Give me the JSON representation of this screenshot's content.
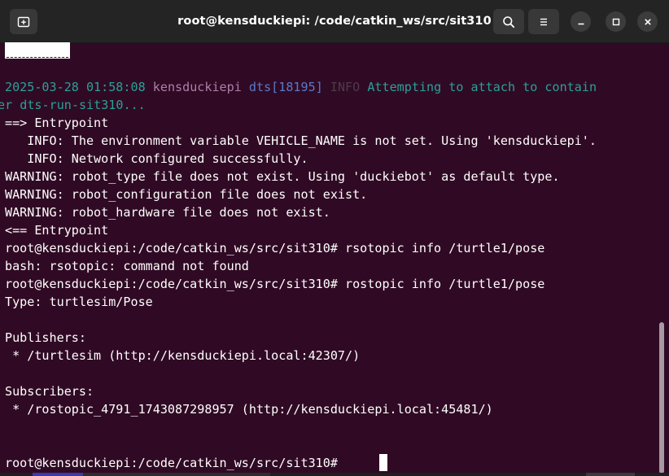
{
  "window": {
    "title": "root@kensduckiepi: /code/catkin_ws/src/sit310"
  },
  "titlebar": {
    "icons": {
      "new_tab": "new-tab-icon",
      "search": "search-icon",
      "menu": "hamburger-menu-icon",
      "minimize": "minimize-icon",
      "maximize": "maximize-icon",
      "close": "close-icon"
    }
  },
  "colors": {
    "terminal_bg": "#300a24",
    "titlebar_bg": "#242424",
    "text": "#ffffff",
    "timestamp": "#2aa198",
    "hostname": "#ad7fa8",
    "process": "#5b79c9",
    "level": "#4e3b4b",
    "message": "#2aa198"
  },
  "terminal": {
    "log": {
      "timestamp": "2025-03-28 01:58:08",
      "host": "kensduckiepi",
      "process": "dts[18195]",
      "level": "INFO",
      "message": "Attempting to attach to contain",
      "wrap": "er dts-run-sit310..."
    },
    "lines": [
      "==> Entrypoint",
      "   INFO: The environment variable VEHICLE_NAME is not set. Using 'kensduckiepi'.",
      "   INFO: Network configured successfully.",
      "WARNING: robot_type file does not exist. Using 'duckiebot' as default type.",
      "WARNING: robot_configuration file does not exist.",
      "WARNING: robot_hardware file does not exist.",
      "<== Entrypoint",
      "root@kensduckiepi:/code/catkin_ws/src/sit310# rsotopic info /turtle1/pose",
      "bash: rsotopic: command not found",
      "root@kensduckiepi:/code/catkin_ws/src/sit310# rostopic info /turtle1/pose",
      "Type: turtlesim/Pose",
      "",
      "Publishers:",
      " * /turtlesim (http://kensduckiepi.local:42307/)",
      "",
      "Subscribers:",
      " * /rostopic_4791_1743087298957 (http://kensduckiepi.local:45481/)",
      "",
      "",
      "root@kensduckiepi:/code/catkin_ws/src/sit310# "
    ]
  }
}
